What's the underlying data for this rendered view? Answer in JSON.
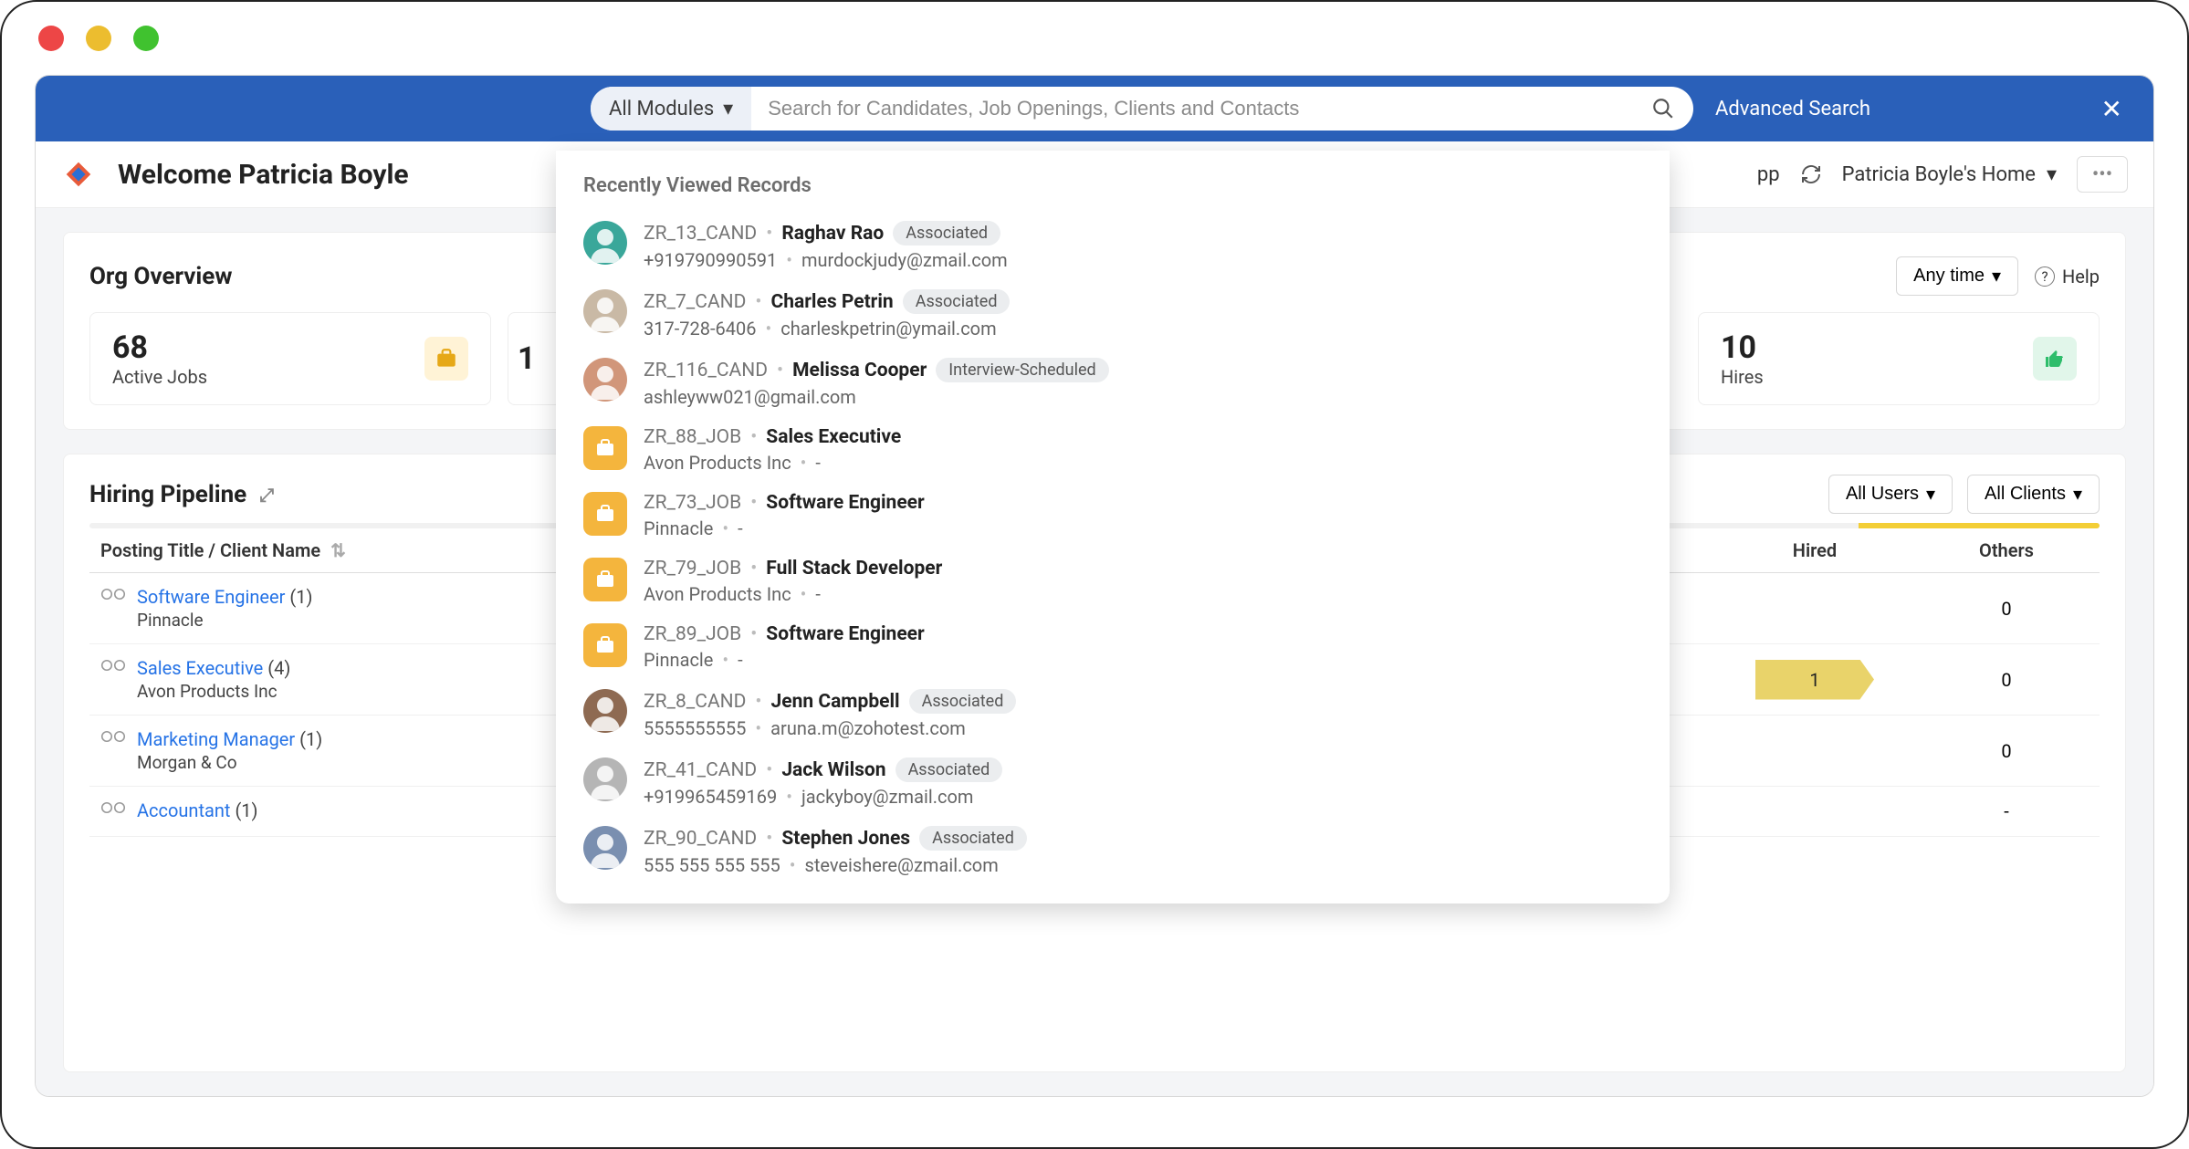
{
  "topbar": {
    "module_label": "All Modules",
    "search_placeholder": "Search for Candidates, Job Openings, Clients and Contacts",
    "adv_search": "Advanced Search"
  },
  "header": {
    "welcome": "Welcome Patricia Boyle",
    "app_suffix": "pp",
    "home_label": "Patricia Boyle's Home"
  },
  "overview": {
    "title": "Org Overview",
    "anytime": "Any time",
    "help": "Help",
    "stats": [
      {
        "value": "68",
        "label": "Active Jobs"
      },
      {
        "value": "1",
        "label": ""
      },
      {
        "value": "10",
        "label": "Hires"
      }
    ]
  },
  "pipeline": {
    "title": "Hiring Pipeline",
    "filter_users": "All Users",
    "filter_clients": "All Clients",
    "col_title": "Posting Title / Client Name",
    "col_hired": "Hired",
    "col_others": "Others",
    "rows": [
      {
        "title": "Software Engineer",
        "count": "(1)",
        "client": "Pinnacle",
        "hired": "",
        "others": "0"
      },
      {
        "title": "Sales Executive",
        "count": "(4)",
        "client": "Avon Products Inc",
        "hired": "1",
        "others": "0"
      },
      {
        "title": "Marketing Manager",
        "count": "(1)",
        "client": "Morgan & Co",
        "hired": "",
        "others": "0"
      },
      {
        "title": "Accountant",
        "count": "(1)",
        "client": "",
        "hired": "",
        "others": "-"
      }
    ]
  },
  "dropdown": {
    "title": "Recently Viewed Records",
    "records": [
      {
        "type": "cand",
        "id": "ZR_13_CAND",
        "name": "Raghav Rao",
        "status": "Associated",
        "phone": "+919790990591",
        "email": "murdockjudy@zmail.com",
        "avatar": "#3aa79a"
      },
      {
        "type": "cand",
        "id": "ZR_7_CAND",
        "name": "Charles Petrin",
        "status": "Associated",
        "phone": "317-728-6406",
        "email": "charleskpetrin@ymail.com",
        "avatar": "#c9b9a5"
      },
      {
        "type": "cand",
        "id": "ZR_116_CAND",
        "name": "Melissa Cooper",
        "status": "Interview-Scheduled",
        "phone": "",
        "email": "ashleyww021@gmail.com",
        "avatar": "#d1967a"
      },
      {
        "type": "job",
        "id": "ZR_88_JOB",
        "name": "Sales Executive",
        "status": "",
        "phone": "Avon Products Inc",
        "email": "-",
        "avatar": ""
      },
      {
        "type": "job",
        "id": "ZR_73_JOB",
        "name": "Software Engineer",
        "status": "",
        "phone": "Pinnacle",
        "email": "-",
        "avatar": ""
      },
      {
        "type": "job",
        "id": "ZR_79_JOB",
        "name": "Full Stack Developer",
        "status": "",
        "phone": "Avon Products Inc",
        "email": "-",
        "avatar": ""
      },
      {
        "type": "job",
        "id": "ZR_89_JOB",
        "name": "Software Engineer",
        "status": "",
        "phone": "Pinnacle",
        "email": "-",
        "avatar": ""
      },
      {
        "type": "cand",
        "id": "ZR_8_CAND",
        "name": "Jenn Campbell",
        "status": "Associated",
        "phone": "5555555555",
        "email": "aruna.m@zohotest.com",
        "avatar": "#8e6a52"
      },
      {
        "type": "cand",
        "id": "ZR_41_CAND",
        "name": "Jack Wilson",
        "status": "Associated",
        "phone": "+919965459169",
        "email": "jackyboy@zmail.com",
        "avatar": "#b5b5b5"
      },
      {
        "type": "cand",
        "id": "ZR_90_CAND",
        "name": "Stephen Jones",
        "status": "Associated",
        "phone": "555 555 555 555",
        "email": "steveishere@zmail.com",
        "avatar": "#7a8fb0"
      }
    ]
  }
}
